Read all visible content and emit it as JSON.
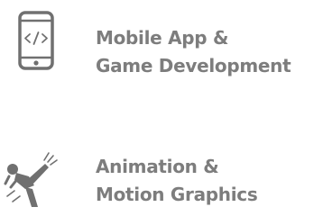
{
  "services": [
    {
      "icon": "mobile-code-icon",
      "title_lines": [
        "Mobile App &",
        "Game Development"
      ]
    },
    {
      "icon": "martial-arts-kick-icon",
      "title_lines": [
        "Animation &",
        "Motion Graphics"
      ]
    }
  ],
  "colors": {
    "icon": "#707070",
    "text": "#7d7d7d",
    "background": "#ffffff"
  }
}
